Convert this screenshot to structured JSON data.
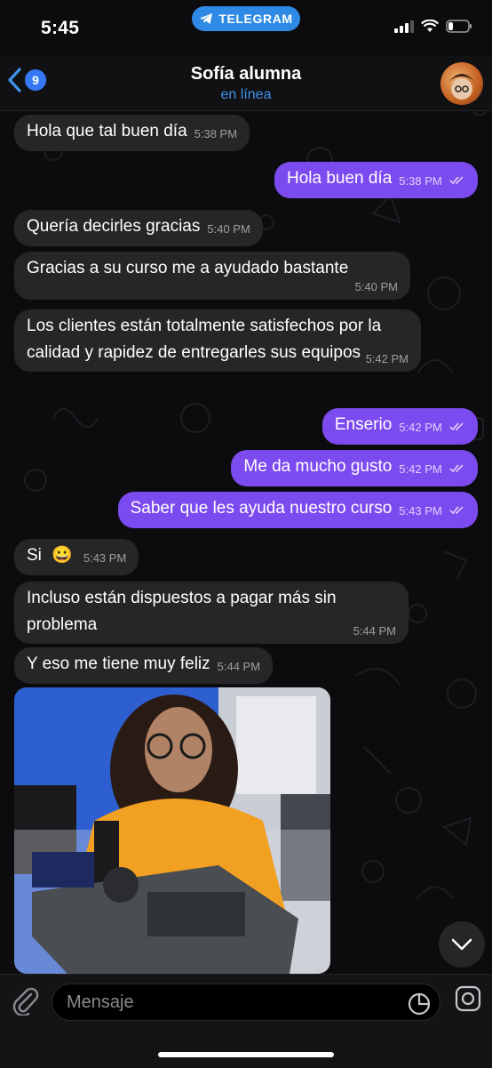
{
  "status_bar": {
    "time": "5:45",
    "app_pill": "TELEGRAM"
  },
  "header": {
    "back_badge": "9",
    "contact_name": "Sofía alumna",
    "status": "en línea"
  },
  "messages": [
    {
      "text": "Hola que tal buen día",
      "time": "5:38 PM",
      "direction": "in"
    },
    {
      "text": "Hola buen día",
      "time": "5:38 PM",
      "direction": "out",
      "read": true
    },
    {
      "text": "Quería decirles gracias",
      "time": "5:40 PM",
      "direction": "in"
    },
    {
      "text": "Gracias a su curso me a ayudado bastante",
      "time": "5:40 PM",
      "direction": "in"
    },
    {
      "text": "Los clientes están totalmente satisfechos por la calidad y rapidez de entregarles sus equipos",
      "time": "5:42 PM",
      "direction": "in"
    },
    {
      "text": "Enserio",
      "time": "5:42 PM",
      "direction": "out",
      "read": true
    },
    {
      "text": "Me da mucho gusto",
      "time": "5:42 PM",
      "direction": "out",
      "read": true
    },
    {
      "text": "Saber que les ayuda nuestro curso",
      "time": "5:43 PM",
      "direction": "out",
      "read": true
    },
    {
      "text": "Si",
      "emoji": "😀",
      "time": "5:43 PM",
      "direction": "in"
    },
    {
      "text": "Incluso están dispuestos a pagar más sin problema",
      "time": "5:44 PM",
      "direction": "in"
    },
    {
      "text": "Y eso me tiene muy feliz",
      "time": "5:44 PM",
      "direction": "in"
    }
  ],
  "input": {
    "placeholder": "Mensaje"
  },
  "colors": {
    "outgoing_bubble": "#7c4bef",
    "incoming_bubble": "#262628",
    "accent": "#3478f6"
  }
}
